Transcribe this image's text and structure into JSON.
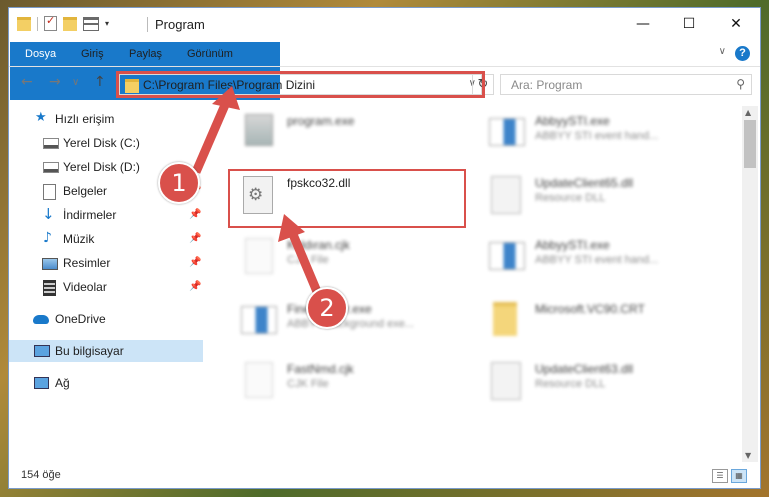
{
  "window": {
    "title": "Program",
    "controls": {
      "minimize": "—",
      "maximize": "☐",
      "close": "✕"
    }
  },
  "ribbon": {
    "tabs": [
      "Dosya",
      "Giriş",
      "Paylaş",
      "Görünüm"
    ],
    "help": "?"
  },
  "navigation": {
    "address": "C:\\Program Files\\Program Dizini",
    "search_placeholder": "Ara: Program"
  },
  "sidebar": {
    "quick_access": "Hızlı erişim",
    "items": [
      {
        "label": "Yerel Disk (C:)",
        "icon": "drive-icon"
      },
      {
        "label": "Yerel Disk (D:)",
        "icon": "drive-icon"
      },
      {
        "label": "Belgeler",
        "icon": "documents-icon"
      },
      {
        "label": "İndirmeler",
        "icon": "downloads-icon"
      },
      {
        "label": "Müzik",
        "icon": "music-icon"
      },
      {
        "label": "Resimler",
        "icon": "pictures-icon"
      },
      {
        "label": "Videolar",
        "icon": "videos-icon"
      }
    ],
    "onedrive": "OneDrive",
    "this_pc": "Bu bilgisayar",
    "network": "Ağ"
  },
  "files": {
    "left": [
      {
        "name": "program.exe",
        "type": ""
      },
      {
        "name": "fpskco32.dll",
        "type": ""
      },
      {
        "name": "Kaldıran.cjk",
        "type": "CJK File"
      },
      {
        "name": "FineReader.exe",
        "type": "ABBYY background exe..."
      },
      {
        "name": "FastNmd.cjk",
        "type": "CJK File"
      }
    ],
    "right": [
      {
        "name": "AbbyySTI.exe",
        "type": "ABBYY STI event hand..."
      },
      {
        "name": "UpdateClient65.dll",
        "type": "Resource DLL"
      },
      {
        "name": "AbbyySTI.exe",
        "type": "ABBYY STI event hand..."
      },
      {
        "name": "Microsoft.VC90.CRT",
        "type": ""
      },
      {
        "name": "UpdateClient63.dll",
        "type": "Resource DLL"
      }
    ]
  },
  "status": {
    "count": "154 öğe"
  },
  "annotations": {
    "step1": "1",
    "step2": "2"
  }
}
